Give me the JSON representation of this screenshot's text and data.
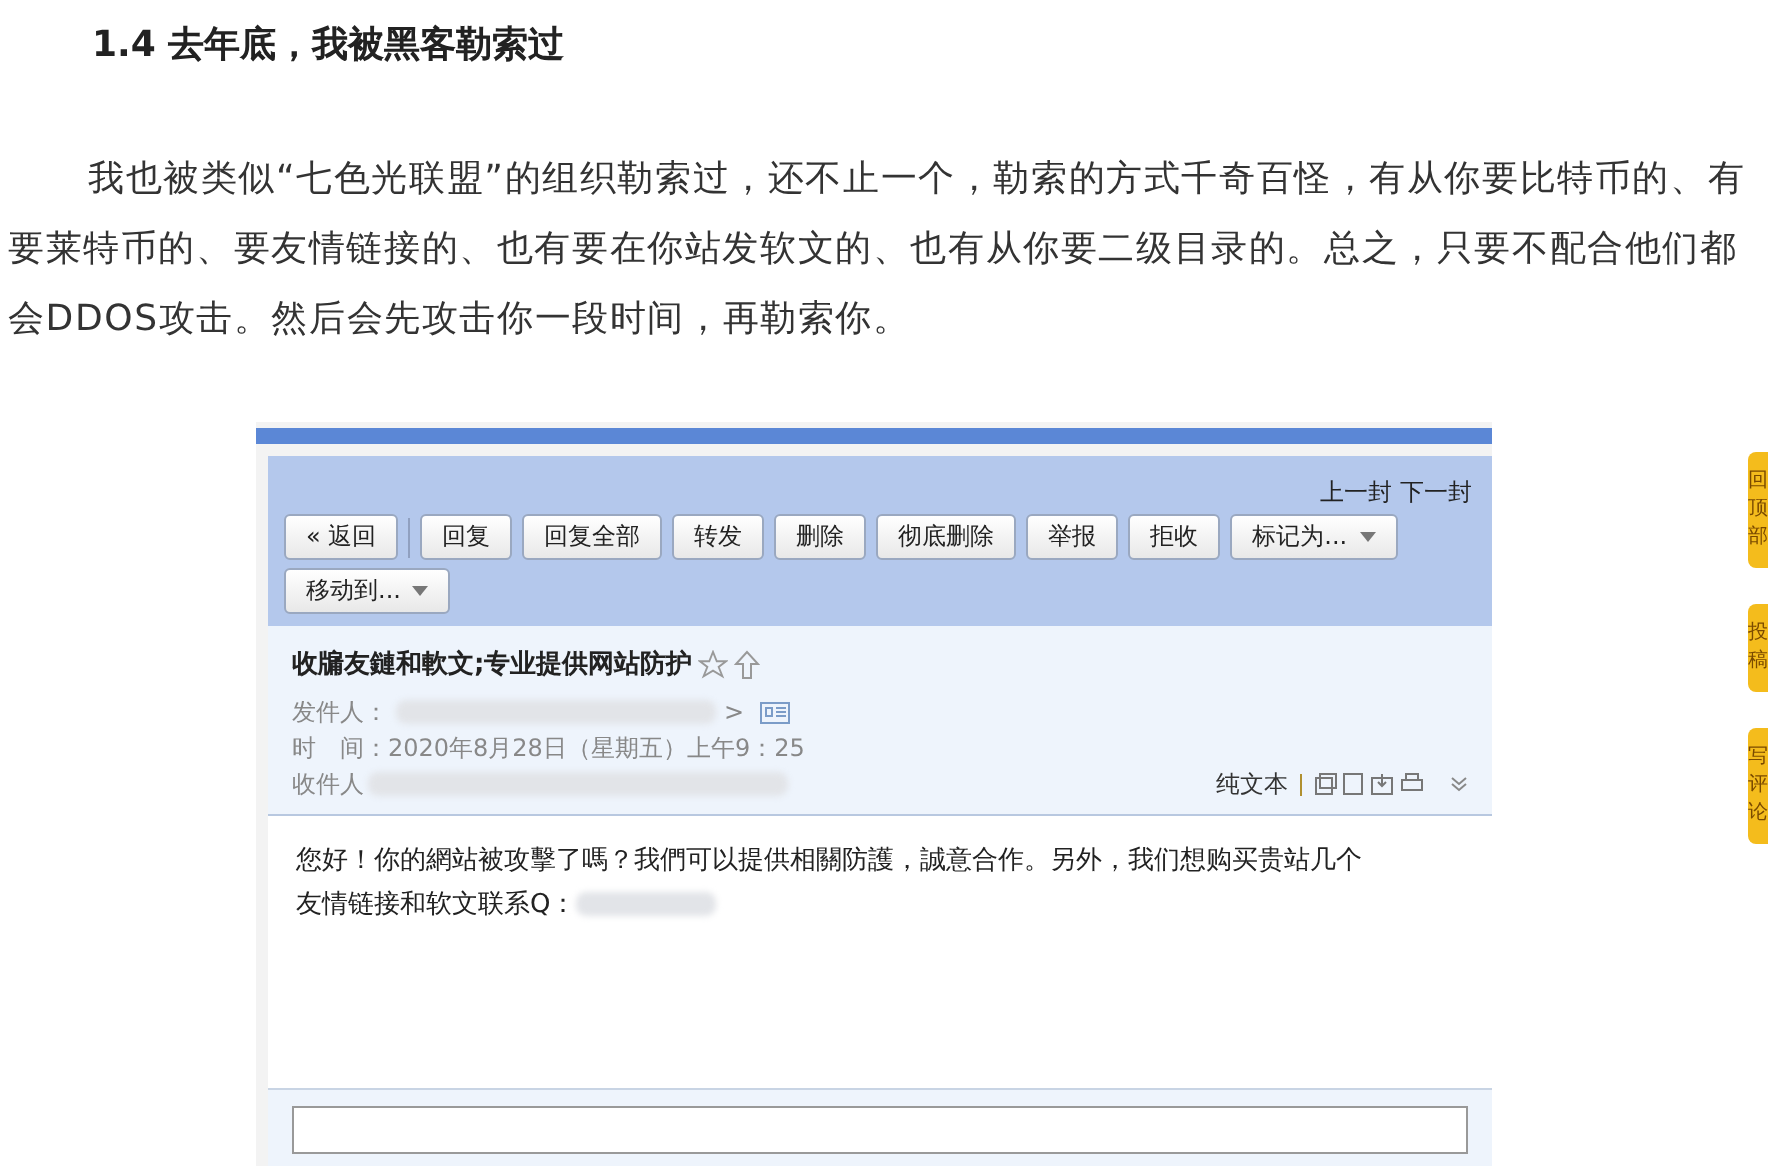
{
  "heading": "1.4 去年底，我被黑客勒索过",
  "paragraph": "我也被类似“七色光联盟”的组织勒索过，还不止一个，勒索的方式千奇百怪，有从你要比特币的、有要莱特币的、要友情链接的、也有要在你站发软文的、也有从你要二级目录的。总之，只要不配合他们都会DDOS攻击。然后会先攻击你一段时间，再勒索你。",
  "email": {
    "nav_links": [
      "上一封",
      "下一封"
    ],
    "buttons": [
      {
        "label": "« 返回",
        "kind": "back"
      },
      {
        "label": "回复",
        "kind": "plain"
      },
      {
        "label": "回复全部",
        "kind": "plain"
      },
      {
        "label": "转发",
        "kind": "plain"
      },
      {
        "label": "删除",
        "kind": "plain"
      },
      {
        "label": "彻底删除",
        "kind": "plain"
      },
      {
        "label": "举报",
        "kind": "plain"
      },
      {
        "label": "拒收",
        "kind": "plain"
      },
      {
        "label": "标记为...",
        "kind": "dropdown"
      },
      {
        "label": "移动到...",
        "kind": "dropdown"
      }
    ],
    "subject": "收牖友鏈和軟文;专业提供网站防护",
    "sender_label": "发件人：",
    "sender_suffix": ">",
    "time_label": "时　间：",
    "time_value": "2020年8月28日（星期五）上午9：25",
    "recipient_label": "收件人",
    "view_mode": "纯文本",
    "body_lines": [
      "您好！你的網站被攻擊了嗎？我們可以提供相關防護，誠意合作。另外，我们想购买贵站几个",
      "友情链接和软文联系Q："
    ]
  },
  "side_tabs": [
    "回顶部",
    "投稿",
    "写评论"
  ]
}
